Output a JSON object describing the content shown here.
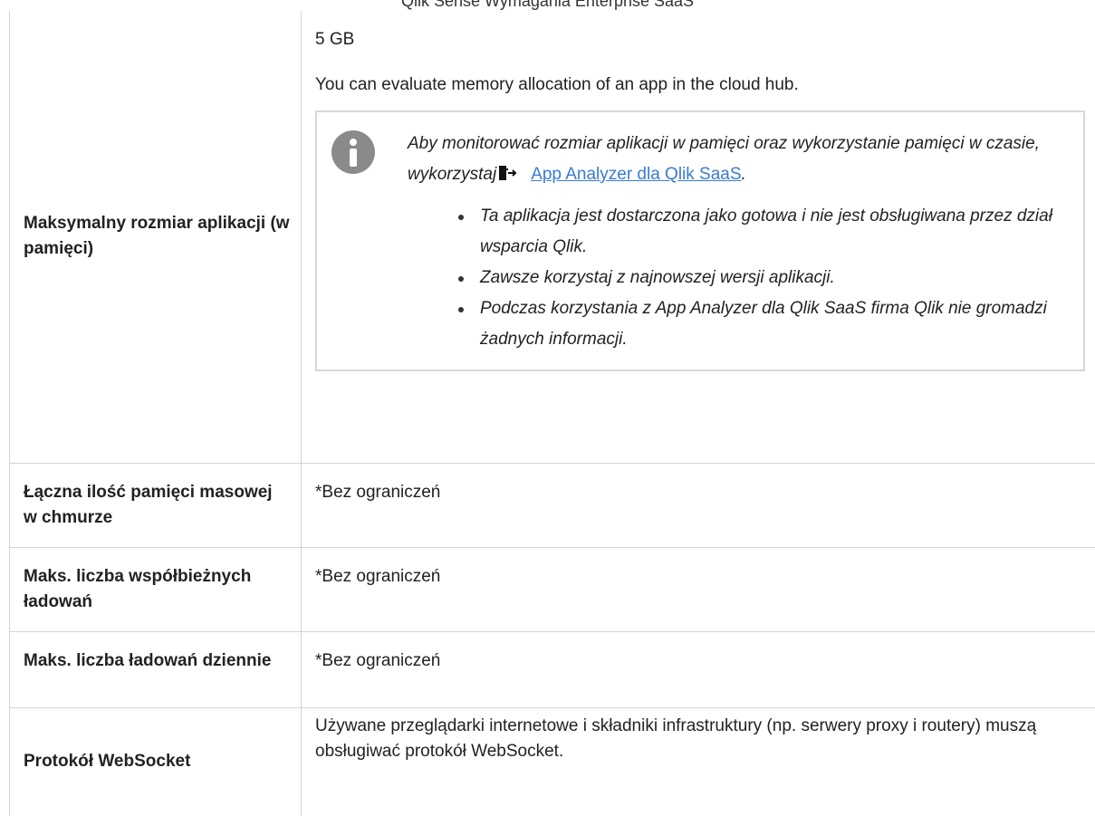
{
  "header": {
    "title": "Qlik Sense Wymagania Enterprise SaaS"
  },
  "rows": [
    {
      "label": "Maksymalny rozmiar aplikacji (w pamięci)",
      "value": "5 GB",
      "description": "You can evaluate memory allocation of an app in the cloud hub.",
      "note": {
        "icon": "info-icon",
        "text_before": "Aby monitorować rozmiar aplikacji w pamięci oraz wykorzystanie pamięci w czasie, wykorzystaj",
        "link_icon": "external-link-icon",
        "link_text": "App Analyzer dla Qlik SaaS",
        "text_after": ".",
        "bullets": [
          "Ta aplikacja jest dostarczona jako gotowa i nie jest obsługiwana przez dział wsparcia Qlik.",
          "Zawsze korzystaj z najnowszej wersji aplikacji.",
          "Podczas korzystania z App Analyzer dla Qlik SaaS firma Qlik nie gromadzi żadnych informacji."
        ]
      }
    },
    {
      "label": "Łączna ilość pamięci masowej w chmurze",
      "value": "*Bez ograniczeń"
    },
    {
      "label": "Maks. liczba współbieżnych ładowań",
      "value": "*Bez ograniczeń"
    },
    {
      "label": "Maks. liczba ładowań dziennie",
      "value": "*Bez ograniczeń"
    },
    {
      "label": "Protokół WebSocket",
      "value": "Używane przeglądarki internetowe i składniki infrastruktury (np. serwery proxy i routery) muszą obsługiwać protokół WebSocket."
    }
  ],
  "colors": {
    "link": "#3a7bd5",
    "border": "#d4d4d4",
    "icon": "#8a8a8a"
  }
}
